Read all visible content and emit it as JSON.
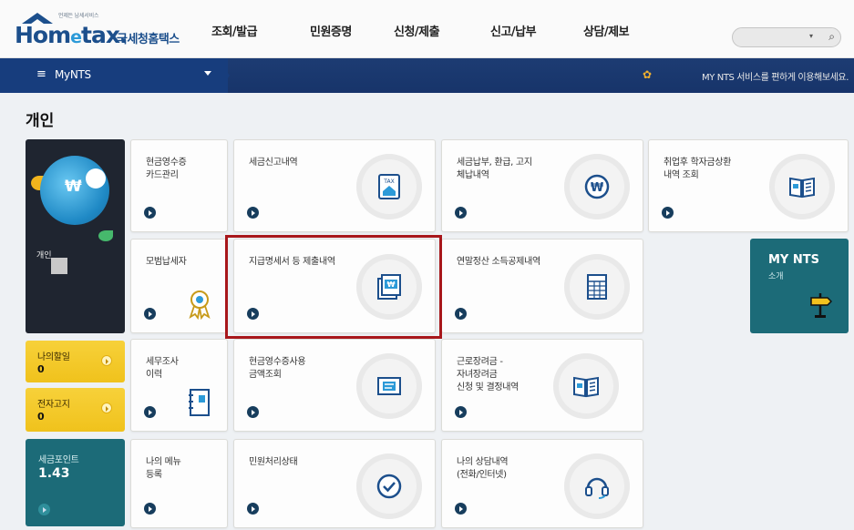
{
  "header": {
    "logo_small": "언제든 납세서비스",
    "logo_main_pre": "Hom",
    "logo_main_e": "e",
    "logo_main_post": "tax.",
    "logo_korean": "국세청홈택스",
    "menu": [
      "조회/발급",
      "민원증명",
      "신청/제출",
      "신고/납부",
      "상담/제보"
    ],
    "search_arrow": "▾",
    "search_icon": "⌕"
  },
  "nav": {
    "menu_icon": "≡",
    "label": "MyNTS",
    "notice_icon": "✿",
    "notice": "MY NTS 서비스를 편하게 이용해보세요."
  },
  "page": {
    "title": "개인"
  },
  "profile": {
    "won": "₩",
    "label": "개인"
  },
  "side": {
    "my_tasks": {
      "title": "나의할일",
      "value": "0"
    },
    "e_notice": {
      "title": "전자고지",
      "value": "0"
    },
    "tax_point": {
      "title": "세금포인트",
      "value": "1.43"
    }
  },
  "tiles": {
    "cash_receipt_card": "현금영수증\n카드관리",
    "tax_report_history": "세금신고내역",
    "tax_payment": "세금납부, 환급, 고지\n체납내역",
    "student_loan": "취업후 학자금상환\n내역 조회",
    "model_taxpayer": "모범납세자",
    "payment_statement": "지급명세서 등 제출내역",
    "year_end": "연말정산 소득공제내역",
    "tax_audit": "세무조사\n이력",
    "cash_receipt_amount": "현금영수증사용\n금액조회",
    "earned_income": "근로장려금 -\n자녀장려금\n신청 및 결정내역",
    "my_menu": "나의 메뉴\n등록",
    "civil_status": "민원처리상태",
    "my_consultation": "나의 상담내역\n(전화/인터넷)"
  },
  "mynts_intro": {
    "title": "MY NTS",
    "sub": "소개"
  },
  "icon_text": {
    "tax": "TAX",
    "won": "₩"
  }
}
